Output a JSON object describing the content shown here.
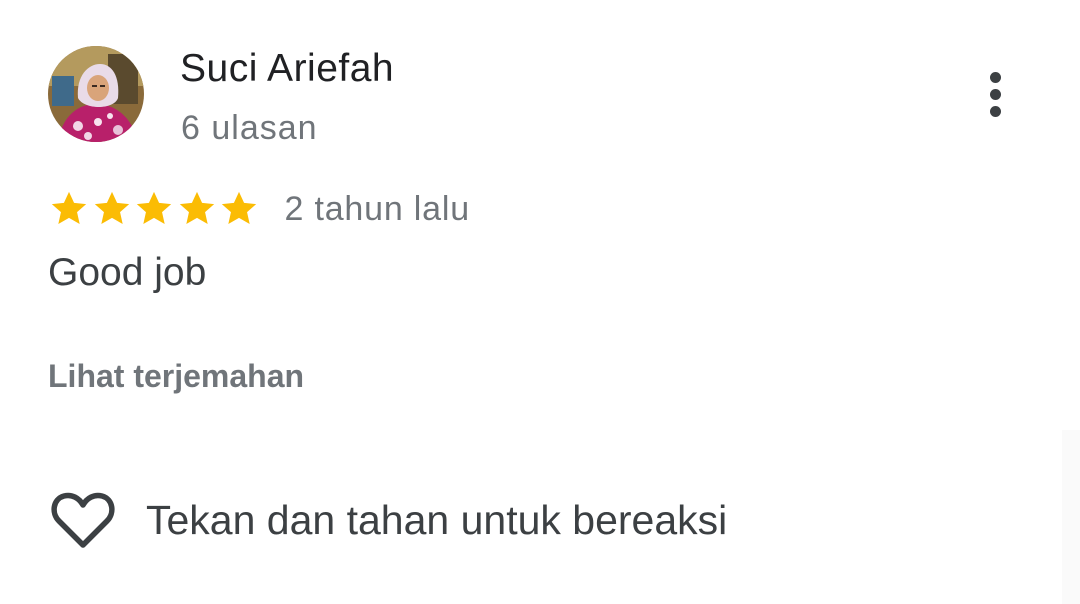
{
  "review": {
    "author": {
      "name": "Suci Ariefah",
      "review_count": "6 ulasan",
      "avatar_icon": "user-photo-avatar"
    },
    "menu_icon": "more-vert-icon",
    "rating": {
      "stars": 5,
      "max": 5,
      "star_color": "#fbbc04"
    },
    "time": "2 tahun lalu",
    "text": "Good job",
    "translate_label": "Lihat terjemahan",
    "reaction": {
      "icon": "heart-outline-icon",
      "label": "Tekan dan tahan untuk bereaksi"
    }
  }
}
